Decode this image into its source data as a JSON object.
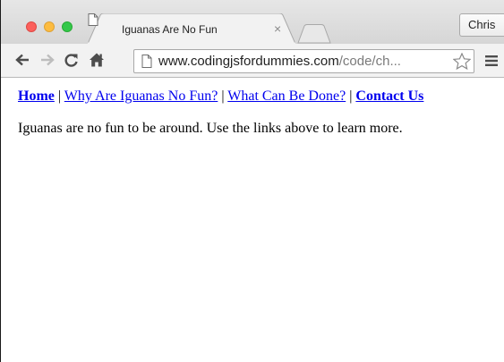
{
  "browser": {
    "tab": {
      "title": "Iguanas Are No Fun",
      "close_glyph": "×",
      "favicon": "page-icon"
    },
    "profile_name": "Chris",
    "toolbar": {
      "back_icon": "back-arrow-icon",
      "forward_icon": "forward-arrow-icon",
      "reload_icon": "reload-icon",
      "home_icon": "home-icon",
      "menu_icon": "hamburger-menu-icon",
      "bookmark_icon": "star-icon"
    },
    "address_bar": {
      "host": "www.codingjsfordummies.com",
      "path": "/code/ch..."
    }
  },
  "page": {
    "nav": [
      {
        "label": "Home",
        "bold": true
      },
      {
        "label": "Why Are Iguanas No Fun?",
        "bold": false
      },
      {
        "label": "What Can Be Done?",
        "bold": false
      },
      {
        "label": "Contact Us",
        "bold": true
      }
    ],
    "separator": " | ",
    "intro": "Iguanas are no fun to be around. Use the links above to learn more.",
    "link_color": "#0000ee"
  }
}
